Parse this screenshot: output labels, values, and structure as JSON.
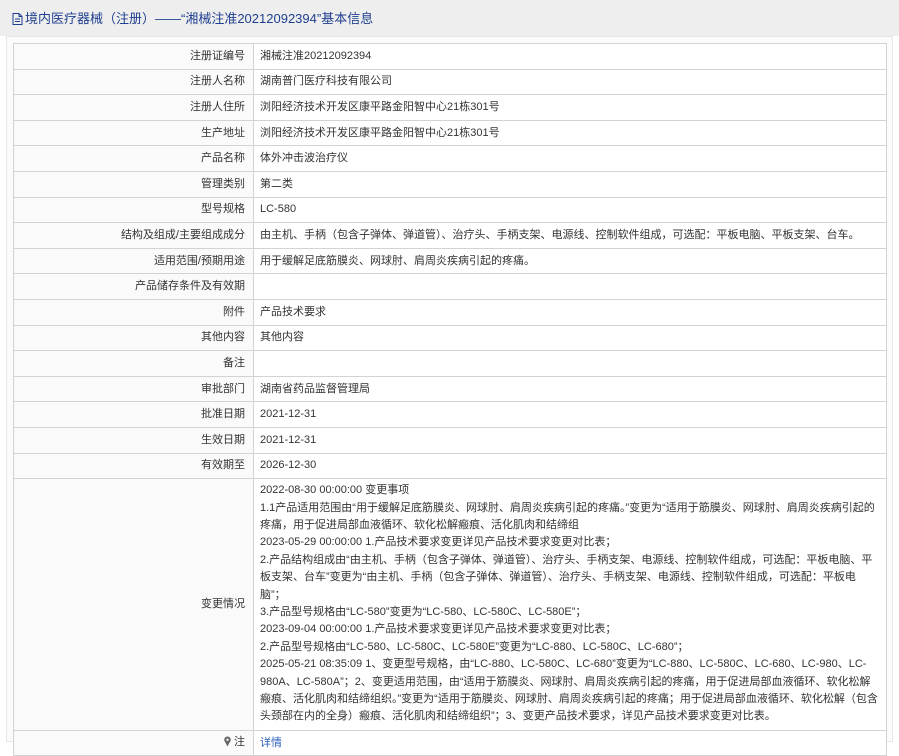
{
  "header": {
    "title": "境内医疗器械（注册）——“湘械注准20212092394”基本信息"
  },
  "rows": [
    {
      "label": "注册证编号",
      "value": "湘械注准20212092394"
    },
    {
      "label": "注册人名称",
      "value": "湖南普门医疗科技有限公司"
    },
    {
      "label": "注册人住所",
      "value": "浏阳经济技术开发区康平路金阳智中心21栋301号"
    },
    {
      "label": "生产地址",
      "value": "浏阳经济技术开发区康平路金阳智中心21栋301号"
    },
    {
      "label": "产品名称",
      "value": "体外冲击波治疗仪"
    },
    {
      "label": "管理类别",
      "value": "第二类"
    },
    {
      "label": "型号规格",
      "value": "LC-580"
    },
    {
      "label": "结构及组成/主要组成成分",
      "value": "由主机、手柄（包含子弹体、弹道管）、治疗头、手柄支架、电源线、控制软件组成，可选配：平板电脑、平板支架、台车。"
    },
    {
      "label": "适用范围/预期用途",
      "value": "用于缓解足底筋膜炎、网球肘、肩周炎疾病引起的疼痛。"
    },
    {
      "label": "产品储存条件及有效期",
      "value": ""
    },
    {
      "label": "附件",
      "value": "产品技术要求"
    },
    {
      "label": "其他内容",
      "value": "其他内容"
    },
    {
      "label": "备注",
      "value": ""
    },
    {
      "label": "审批部门",
      "value": "湖南省药品监督管理局"
    },
    {
      "label": "批准日期",
      "value": "2021-12-31"
    },
    {
      "label": "生效日期",
      "value": "2021-12-31"
    },
    {
      "label": "有效期至",
      "value": "2026-12-30"
    }
  ],
  "changes": {
    "label": "变更情况",
    "lines": [
      "2022-08-30 00:00:00 变更事项",
      "1.1产品适用范围由“用于缓解足底筋膜炎、网球肘、肩周炎疾病引起的疼痛。”变更为“适用于筋膜炎、网球肘、肩周炎疾病引起的疼痛，用于促进局部血液循环、软化松解瘢痕、活化肌肉和结缔组",
      "2023-05-29 00:00:00 1.产品技术要求变更详见产品技术要求变更对比表；",
      "2.产品结构组成由“由主机、手柄（包含子弹体、弹道管）、治疗头、手柄支架、电源线、控制软件组成，可选配：平板电脑、平板支架、台车”变更为“由主机、手柄（包含子弹体、弹道管）、治疗头、手柄支架、电源线、控制软件组成，可选配：平板电脑”；",
      "3.产品型号规格由“LC-580”变更为“LC-580、LC-580C、LC-580E”；",
      "2023-09-04 00:00:00 1.产品技术要求变更详见产品技术要求变更对比表；",
      "2.产品型号规格由“LC-580、LC-580C、LC-580E”变更为“LC-880、LC-580C、LC-680”；",
      "2025-05-21 08:35:09 1、变更型号规格，由“LC-880、LC-580C、LC-680”变更为“LC-880、LC-580C、LC-680、LC-980、LC-980A、LC-580A”；2、变更适用范围，由“适用于筋膜炎、网球肘、肩周炎疾病引起的疼痛，用于促进局部血液循环、软化松解瘢痕、活化肌肉和结缔组织。”变更为“适用于筋膜炎、网球肘、肩周炎疾病引起的疼痛；用于促进局部血液循环、软化松解（包含头颈部在内的全身）瘢痕、活化肌肉和结缔组织”；3、变更产品技术要求，详见产品技术要求变更对比表。"
    ]
  },
  "note": {
    "label": "注",
    "link": "详情",
    "icon": "pin-icon"
  }
}
